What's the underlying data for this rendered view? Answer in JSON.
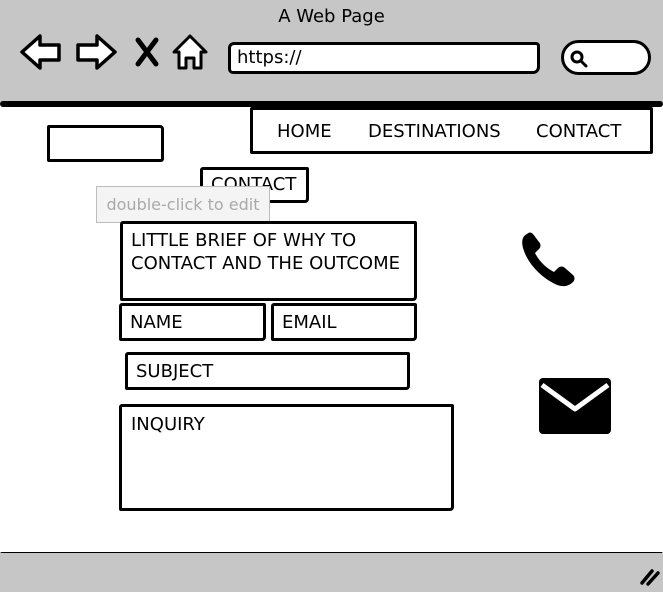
{
  "browser": {
    "title": "A Web Page",
    "url": "https://",
    "icons": {
      "back": "back-arrow-icon",
      "forward": "forward-arrow-icon",
      "stop": "close-icon",
      "home": "home-icon",
      "search": "search-icon"
    }
  },
  "nav": {
    "items": [
      "HOME",
      "DESTINATIONS",
      "CONTACT"
    ]
  },
  "page": {
    "heading": "CONTACT",
    "tooltip": "double-click to edit",
    "brief": "LITTLE BRIEF OF WHY TO CONTACT AND THE OUTCOME",
    "fields": {
      "name": "NAME",
      "email": "EMAIL",
      "subject": "SUBJECT",
      "inquiry": "INQUIRY"
    },
    "icons": {
      "phone": "phone-icon",
      "mail": "mail-icon"
    }
  },
  "colors": {
    "chrome": "#c6c6c6",
    "ink": "#000000",
    "tooltip_text": "#a9a9a9"
  }
}
